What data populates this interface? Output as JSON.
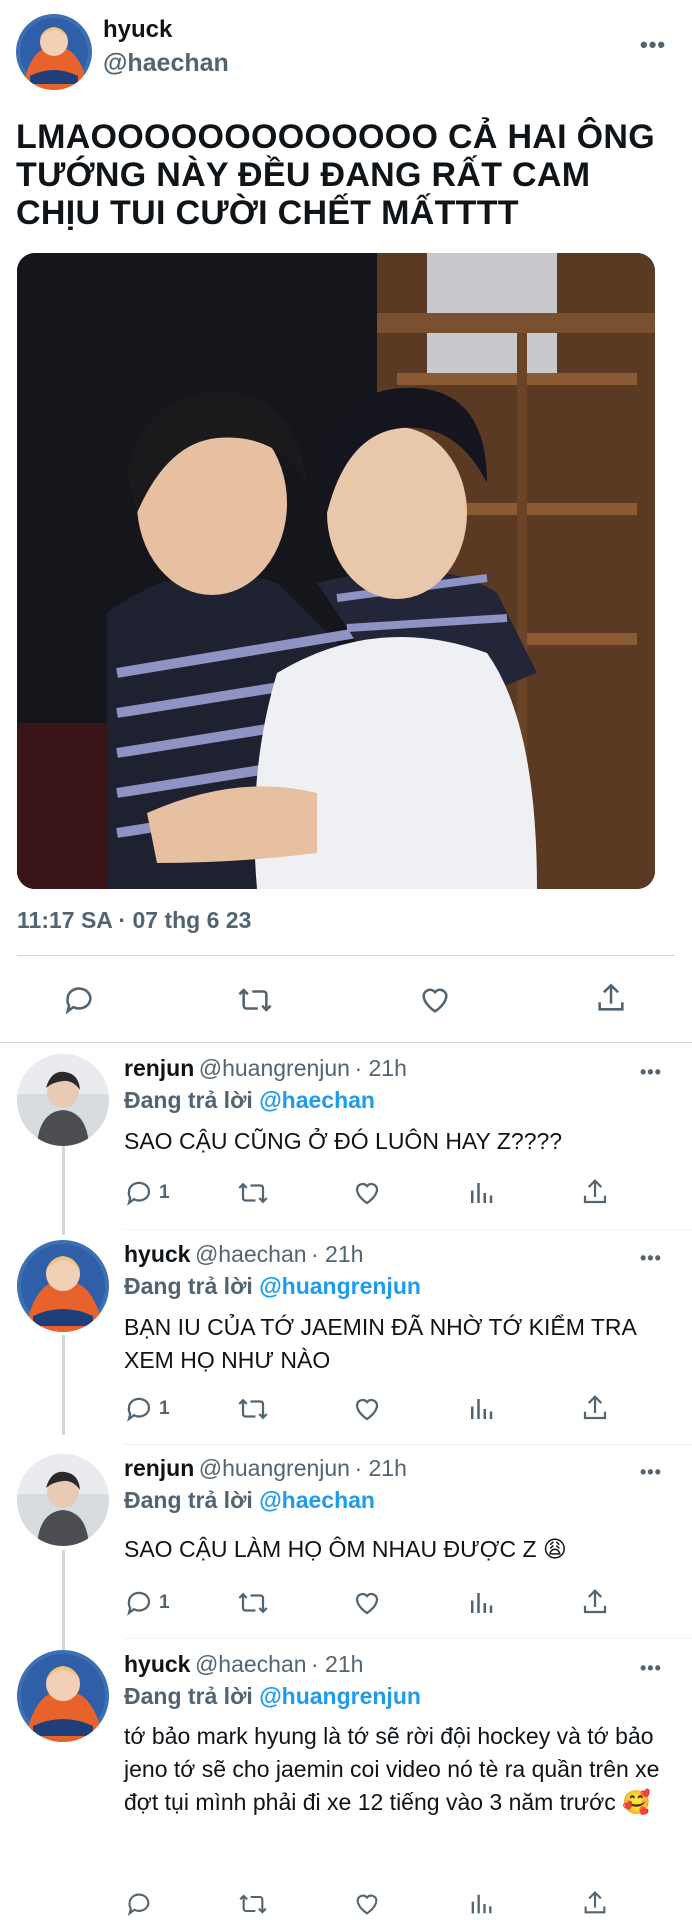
{
  "main_tweet": {
    "name": "hyuck",
    "handle": "@haechan",
    "text": "LMAOOOOOOOOOOOOO CẢ HAI ÔNG TƯỚNG NÀY ĐỀU ĐANG RẤT CAM CHỊU TUI CƯỜI CHẾT MẤTTTT",
    "timestamp": "11:17 SA · 07 thg 6 23",
    "more": "•••"
  },
  "replies": [
    {
      "name": "renjun",
      "handle": "@huangrenjun",
      "time": "· 21h",
      "replying_prefix": "Đang trả lời",
      "replying_to": "@haechan",
      "text": "SAO CẬU CŨNG Ở ĐÓ LUÔN HAY Z????",
      "reply_count": "1"
    },
    {
      "name": "hyuck",
      "handle": "@haechan",
      "time": "· 21h",
      "replying_prefix": "Đang trả lời",
      "replying_to": "@huangrenjun",
      "text": "BẠN IU CỦA TỚ JAEMIN ĐÃ NHỜ TỚ KIỂM TRA XEM HỌ NHƯ NÀO",
      "reply_count": "1"
    },
    {
      "name": "renjun",
      "handle": "@huangrenjun",
      "time": "· 21h",
      "replying_prefix": "Đang trả lời",
      "replying_to": "@haechan",
      "text": "SAO CẬU LÀM HỌ ÔM NHAU ĐƯỢC Z 😩",
      "reply_count": "1"
    },
    {
      "name": "hyuck",
      "handle": "@haechan",
      "time": "· 21h",
      "replying_prefix": "Đang trả lời",
      "replying_to": "@huangrenjun",
      "text": "tớ bảo mark hyung là tớ sẽ rời đội hockey và tớ bảo jeno tớ sẽ cho jaemin coi video nó tè ra quần trên xe đợt tụi mình phải đi xe 12 tiếng vào 3 năm trước 🥰",
      "reply_count": ""
    }
  ],
  "colors": {
    "accent": "#1d9bf0",
    "secondary_text": "#536471",
    "divider": "#cfd9de"
  },
  "icons": [
    "reply-icon",
    "retweet-icon",
    "like-icon",
    "views-icon",
    "share-icon",
    "more-icon"
  ]
}
